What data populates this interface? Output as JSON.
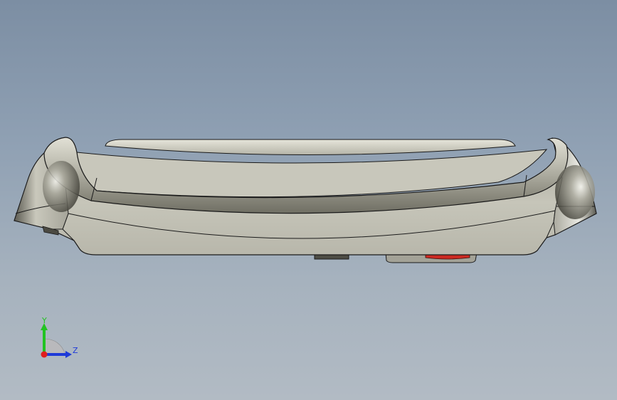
{
  "viewport": {
    "background_top": "#7c8ea3",
    "background_bottom": "#b2bbc4"
  },
  "model": {
    "body_color": "#c2c1b5",
    "edge_color": "#1a1a1a",
    "button_color": "#cc2a22"
  },
  "triad": {
    "y_label": "Y",
    "z_label": "Z",
    "y_color": "#22c322",
    "z_color": "#1e3ad8",
    "x_color": "#e01e1e"
  }
}
